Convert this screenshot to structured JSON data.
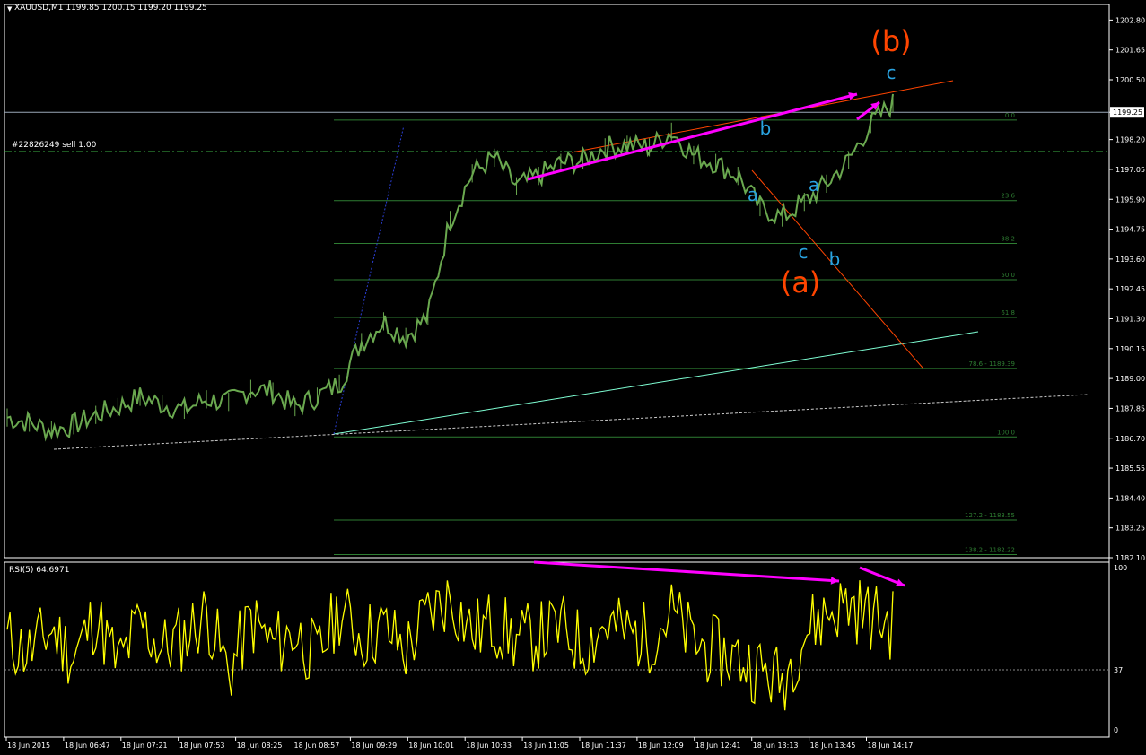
{
  "header": {
    "symbol_line": "XAUUSD,M1  1199.85 1200.15 1199.20 1199.25",
    "trade_label": "#22826249 sell 1.00"
  },
  "price_axis": {
    "ticks": [
      "1202.80",
      "1201.65",
      "1200.50",
      "1199.25",
      "1198.20",
      "1197.05",
      "1195.90",
      "1194.75",
      "1193.60",
      "1192.45",
      "1191.30",
      "1190.15",
      "1189.00",
      "1187.85",
      "1186.70",
      "1185.55",
      "1184.40",
      "1183.25",
      "1182.10"
    ],
    "current_price": "1199.25",
    "range": [
      1182.1,
      1203.4
    ]
  },
  "rsi_panel": {
    "label": "RSI(5) 64.6971",
    "ticks": [
      "100",
      "37",
      "0"
    ],
    "level": 37
  },
  "time_axis": {
    "labels": [
      "18 Jun 2015",
      "18 Jun 06:47",
      "18 Jun 07:21",
      "18 Jun 07:53",
      "18 Jun 08:25",
      "18 Jun 08:57",
      "18 Jun 09:29",
      "18 Jun 10:01",
      "18 Jun 10:33",
      "18 Jun 11:05",
      "18 Jun 11:37",
      "18 Jun 12:09",
      "18 Jun 12:41",
      "18 Jun 13:13",
      "18 Jun 13:45",
      "18 Jun 14:17"
    ]
  },
  "fib_levels": [
    {
      "label": "0.0",
      "price": 1198.95
    },
    {
      "label": "23.6",
      "price": 1195.85
    },
    {
      "label": "38.2",
      "price": 1194.2
    },
    {
      "label": "50.0",
      "price": 1192.8
    },
    {
      "label": "61.8",
      "price": 1191.35
    },
    {
      "label": "78.6 - 1189.39",
      "price": 1189.39
    },
    {
      "label": "100.0",
      "price": 1186.75
    },
    {
      "label": "127.2 - 1183.55",
      "price": 1183.55
    },
    {
      "label": "138.2 - 1182.22",
      "price": 1182.22
    }
  ],
  "wave_labels": {
    "big_b": "(b)",
    "big_a": "(a)",
    "small_c_top": "c",
    "small_b_top": "b",
    "small_a_left": "a",
    "small_a_right": "a",
    "small_c_bottom": "c",
    "small_b_bottom": "b"
  },
  "colors": {
    "background": "#000000",
    "candles": "#6aa84f",
    "rsi_line": "#ffff00",
    "fib": "#2e7d32",
    "magenta": "#ff00ff",
    "orange_red": "#ff4500",
    "wave_blue": "#29a3e0",
    "trendline_cyan": "#7fffd4"
  },
  "chart_data": {
    "type": "line",
    "title": "XAUUSD,M1",
    "series": [
      {
        "name": "XAUUSD,M1",
        "values": [
          1187.5,
          1187.3,
          1187.0,
          1187.2,
          1187.6,
          1187.9,
          1188.3,
          1188.0,
          1187.8,
          1188.2,
          1188.1,
          1188.6,
          1188.5,
          1187.9,
          1188.3,
          1188.8,
          1190.4,
          1191.2,
          1190.6,
          1191.4,
          1195.1,
          1196.9,
          1197.5,
          1196.4,
          1196.8,
          1197.3,
          1197.4,
          1197.9,
          1198.0,
          1197.9,
          1198.5,
          1197.6,
          1197.3,
          1196.8,
          1195.6,
          1195.2,
          1195.8,
          1196.5,
          1197.4,
          1198.8,
          1199.6
        ]
      },
      {
        "name": "RSI(5)",
        "values": [
          55,
          48,
          62,
          45,
          70,
          40,
          66,
          50,
          58,
          72,
          35,
          68,
          52,
          60,
          44,
          74,
          57,
          63,
          49,
          71,
          82,
          60,
          66,
          55,
          58,
          63,
          52,
          65,
          60,
          57,
          72,
          54,
          48,
          44,
          37,
          30,
          60,
          72,
          78,
          70,
          64.7
        ]
      }
    ],
    "ylim": [
      1182.1,
      1203.4
    ]
  }
}
